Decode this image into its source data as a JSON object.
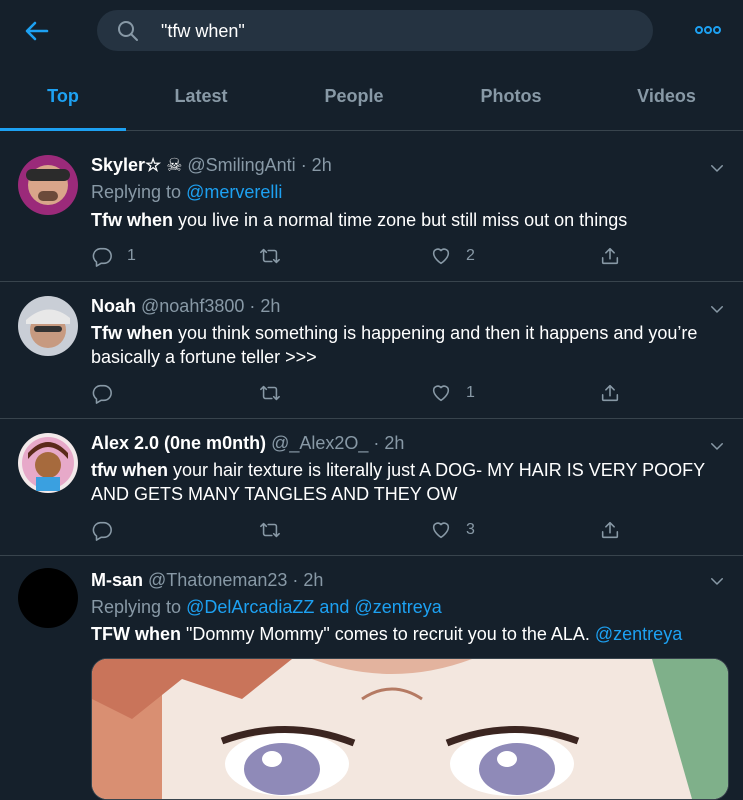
{
  "search": {
    "query": "\"tfw when\""
  },
  "tabs": [
    {
      "label": "Top"
    },
    {
      "label": "Latest"
    },
    {
      "label": "People"
    },
    {
      "label": "Photos"
    },
    {
      "label": "Videos"
    }
  ],
  "colors": {
    "background": "#15202b",
    "accent": "#1da1f2",
    "secondary_text": "#8899a6",
    "border": "#38444d"
  },
  "icons": [
    "back-arrow-icon",
    "search-icon",
    "more-icon",
    "reply-icon",
    "retweet-icon",
    "like-icon",
    "share-icon",
    "chevron-down-icon"
  ],
  "tweets": [
    {
      "name": "Skyler☆",
      "emoji": "☠",
      "handle": "@SmilingAnti",
      "time": "· 2h",
      "replying_prefix": "Replying to ",
      "replying_to": "@merverelli",
      "highlight": "Tfw when",
      "text": " you live in a normal time zone but still miss out on things",
      "replies": "1",
      "retweets": "",
      "likes": "2"
    },
    {
      "name": "Noah",
      "handle": "@noahf3800",
      "time": "· 2h",
      "highlight": "Tfw when",
      "text": " you think something is happening and then it happens and you’re basically a fortune teller >>>",
      "replies": "",
      "retweets": "",
      "likes": "1"
    },
    {
      "name": "Alex 2.0 (0ne m0nth)",
      "handle": "@_Alex2O_",
      "time": "· 2h",
      "highlight": "tfw when",
      "text": " your hair texture is literally just A DOG- MY HAIR IS VERY POOFY AND GETS MANY TANGLES AND THEY OW",
      "replies": "",
      "retweets": "",
      "likes": "3"
    },
    {
      "name": "M-san",
      "handle": "@Thatoneman23",
      "time": "· 2h",
      "replying_prefix": "Replying to ",
      "replying_to_1": "@DelArcadiaZZ",
      "replying_and": " and ",
      "replying_to_2": "@zentreya",
      "highlight": "TFW when",
      "text": " \"Dommy Mommy\" comes to recruit you to the ALA. ",
      "mention": "@zentreya"
    }
  ]
}
